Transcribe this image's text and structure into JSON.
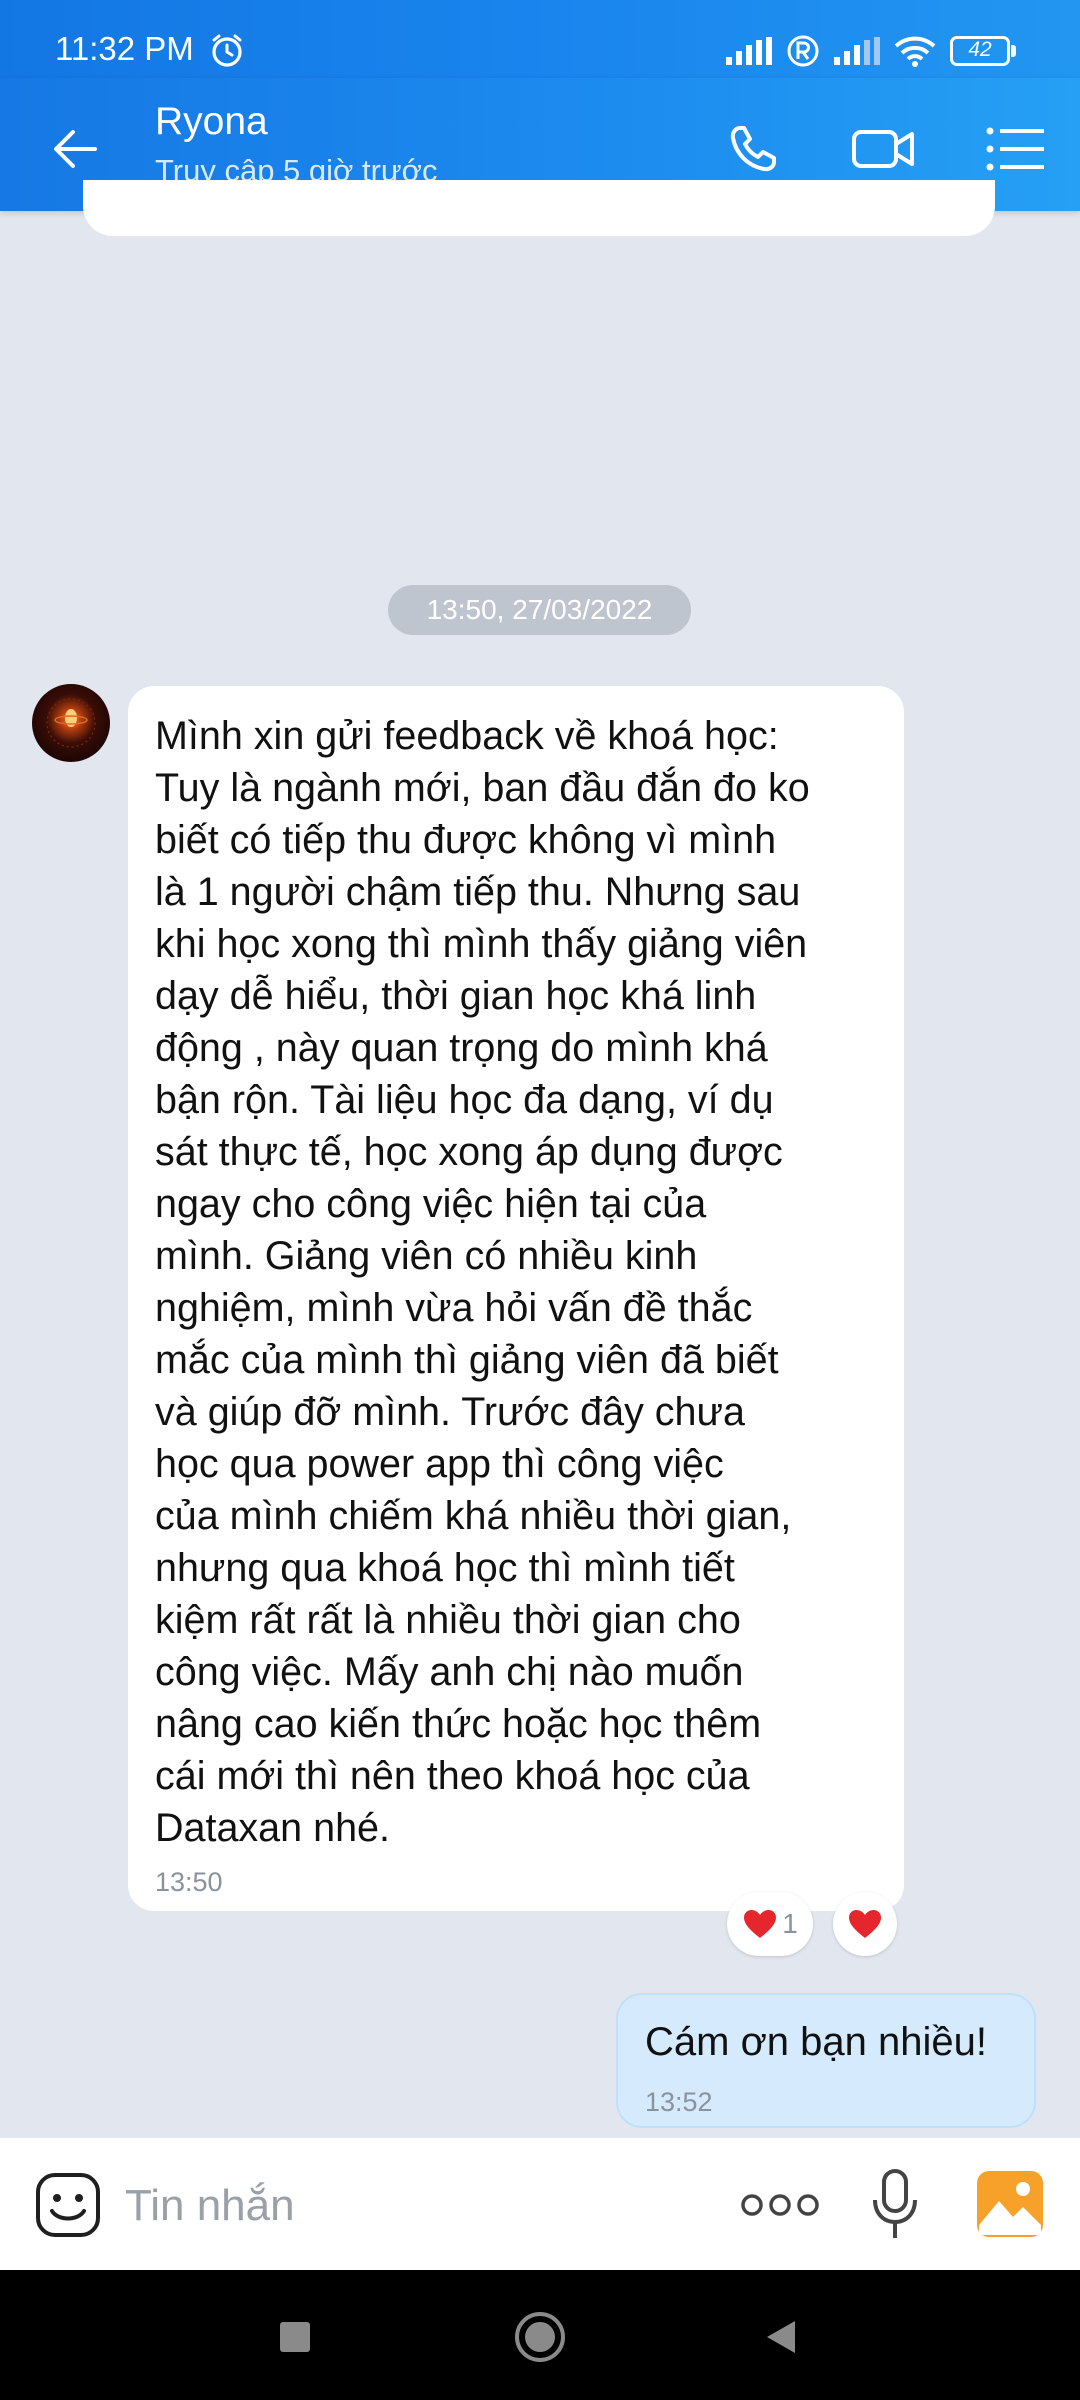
{
  "status_bar": {
    "time": "11:32 PM",
    "battery": "42"
  },
  "header": {
    "contact_name": "Ryona",
    "contact_status": "Truy cập 5 giờ trước",
    "accent": "#1a86ee"
  },
  "conversation": {
    "date_separator": "13:50, 27/03/2022",
    "incoming": {
      "text": "Mình xin gửi feedback về khoá học:\nTuy là ngành mới, ban đầu đắn đo ko\nbiết có tiếp thu được không vì mình\nlà 1 người chậm tiếp thu. Nhưng sau\nkhi học xong thì mình thấy giảng viên\ndạy dễ hiểu, thời gian học khá linh\nđộng , này quan trọng do mình khá\nbận rộn. Tài liệu học đa dạng, ví dụ\nsát thực tế, học xong áp dụng được\nngay cho công việc hiện tại của\nmình. Giảng viên có nhiều kinh\nnghiệm, mình vừa hỏi vấn đề thắc\nmắc của mình thì giảng viên đã biết\nvà giúp đỡ mình. Trước đây chưa\nhọc qua power app thì  công việc\ncủa mình chiếm khá nhiều thời gian,\nnhưng qua khoá học thì mình tiết\nkiệm rất rất là nhiều thời gian cho\ncông việc. Mấy anh chị nào muốn\nnâng cao kiến thức hoặc học thêm\ncái mới thì nên theo khoá học của\nDataxan nhé.",
      "time": "13:50",
      "reaction_count": "1"
    },
    "outgoing": {
      "text": "Cám ơn bạn nhiều!",
      "time": "13:52",
      "bubble_color": "#d5ebfd"
    }
  },
  "composer": {
    "placeholder": "Tin nhắn",
    "icons": [
      "emoji-icon",
      "more-icon",
      "microphone-icon",
      "image-icon"
    ]
  },
  "nav": {
    "icons": [
      "recent-apps-icon",
      "home-icon",
      "back-icon"
    ]
  }
}
